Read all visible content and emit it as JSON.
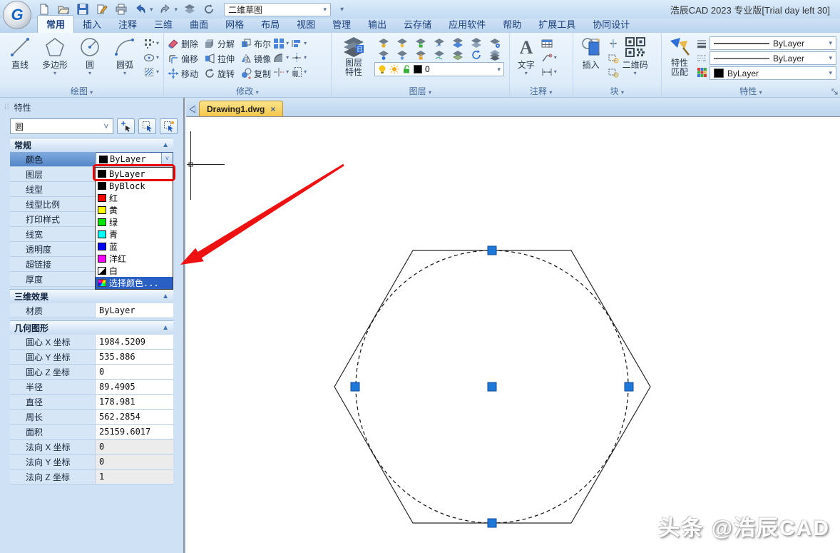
{
  "titlebar": {
    "title": "浩辰CAD 2023 专业版[Trial day left 30]",
    "workspace": "二维草图",
    "logo_letter": "G",
    "quick_access_icons": [
      "new-file-icon",
      "open-file-icon",
      "save-icon",
      "plot-icon",
      "print-icon",
      "undo-icon",
      "redo-icon",
      "layer-stack-icon",
      "recover-icon"
    ]
  },
  "ribbon": {
    "tabs": [
      "常用",
      "插入",
      "注释",
      "三维",
      "曲面",
      "网格",
      "布局",
      "视图",
      "管理",
      "输出",
      "云存储",
      "应用软件",
      "帮助",
      "扩展工具",
      "协同设计"
    ],
    "active_tab": "常用",
    "draw": {
      "label": "绘图",
      "buttons": [
        "直线",
        "多边形",
        "圆",
        "圆弧"
      ],
      "small_icons": [
        "point-grid-icon",
        "ellipse-icon",
        "hatch-icon"
      ]
    },
    "modify": {
      "label": "修改",
      "buttons": [
        "删除",
        "分解",
        "布尔",
        "偏移",
        "拉伸",
        "镜像",
        "移动",
        "旋转",
        "复制"
      ],
      "small_icons": [
        "array-icon",
        "fillet-icon",
        "break-icon",
        "align-icon",
        "divide-icon",
        "scale-icon"
      ]
    },
    "layer": {
      "label": "图层",
      "big_button": "图层特性",
      "current_layer": "0",
      "combo_icons": [
        "bulb-icon",
        "sun-icon",
        "unlock-icon",
        "layer-color-swatch"
      ]
    },
    "annotate": {
      "label": "注释",
      "big_button": "文字",
      "small_icons": [
        "table-icon",
        "leader-icon",
        "dimension-icon"
      ]
    },
    "block": {
      "label": "块",
      "big_button": "插入",
      "qr_button": "二维码",
      "small_icons": [
        "attach-icon",
        "base-point-icon",
        "attribute-icon"
      ]
    },
    "props": {
      "label": "特性",
      "big_button": "特性匹配",
      "combos": [
        "ByLayer",
        "ByLayer",
        "ByLayer"
      ],
      "small_icons": [
        "lineweight-icon",
        "linetype-icon",
        "color-grid-icon"
      ]
    }
  },
  "properties_panel": {
    "title": "特性",
    "selector_value": "圆",
    "toolbar_icons": [
      "quick-select-icon",
      "select-objects-icon",
      "toggle-pickadd-icon"
    ],
    "sec_general": "常规",
    "rows_general": [
      "颜色",
      "图层",
      "线型",
      "线型比例",
      "打印样式",
      "线宽",
      "透明度",
      "超链接",
      "厚度"
    ],
    "color_value": "ByLayer",
    "sec_3d": "三维效果",
    "material_label": "材质",
    "material_value": "ByLayer",
    "sec_geometry": "几何图形",
    "geom_rows": [
      {
        "label": "圆心 X 坐标",
        "value": "1984.5209"
      },
      {
        "label": "圆心 Y 坐标",
        "value": "535.886"
      },
      {
        "label": "圆心 Z 坐标",
        "value": "0"
      },
      {
        "label": "半径",
        "value": "89.4905"
      },
      {
        "label": "直径",
        "value": "178.981"
      },
      {
        "label": "周长",
        "value": "562.2854"
      },
      {
        "label": "面积",
        "value": "25159.6017"
      },
      {
        "label": "法向 X 坐标",
        "value": "0"
      },
      {
        "label": "法向 Y 坐标",
        "value": "0"
      },
      {
        "label": "法向 Z 坐标",
        "value": "1"
      }
    ]
  },
  "color_dropdown": {
    "items": [
      {
        "label": "ByLayer",
        "color": "#000000"
      },
      {
        "label": "ByBlock",
        "color": "#000000"
      },
      {
        "label": "红",
        "color": "#ff0000"
      },
      {
        "label": "黄",
        "color": "#ffff00"
      },
      {
        "label": "绿",
        "color": "#00e400"
      },
      {
        "label": "青",
        "color": "#00ffff"
      },
      {
        "label": "蓝",
        "color": "#0000ff"
      },
      {
        "label": "洋红",
        "color": "#ff00ff"
      },
      {
        "label": "白",
        "color": "#ffffff"
      },
      {
        "label": "选择颜色...",
        "color": "palette",
        "selected": true
      }
    ]
  },
  "document": {
    "tab_label": "Drawing1.dwg",
    "close_glyph": "×"
  },
  "annotation": {
    "highlight_color": "#e80000",
    "arrow_color": "#ee1111"
  },
  "watermark": "头条 @浩辰CAD"
}
